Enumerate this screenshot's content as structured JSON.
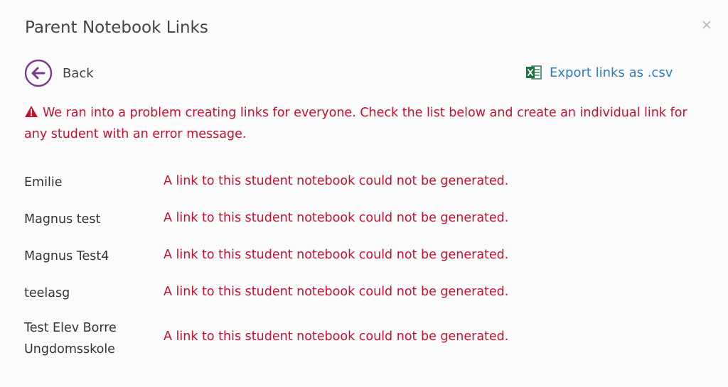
{
  "dialog": {
    "title": "Parent Notebook Links",
    "close_icon": "close-icon"
  },
  "toolbar": {
    "back_label": "Back",
    "back_icon": "arrow-left-circle-icon",
    "export_label": "Export links as .csv",
    "export_icon": "excel-icon"
  },
  "error": {
    "icon": "warning-icon",
    "message": "We ran into a problem creating links for everyone. Check the list below and create an individual link for any student with an error message."
  },
  "students": [
    {
      "name": "Emilie",
      "status": "A link to this student notebook could not be generated."
    },
    {
      "name": "Magnus test",
      "status": "A link to this student notebook could not be generated."
    },
    {
      "name": "Magnus Test4",
      "status": "A link to this student notebook could not be generated."
    },
    {
      "name": "teelasg",
      "status": "A link to this student notebook could not be generated."
    },
    {
      "name": "Test Elev Borre Ungdomsskole",
      "status": "A link to this student notebook could not be generated."
    }
  ],
  "colors": {
    "error": "#c8102e",
    "link": "#2f7bbd",
    "back_icon": "#7a3a8c",
    "excel": "#1e7145"
  }
}
